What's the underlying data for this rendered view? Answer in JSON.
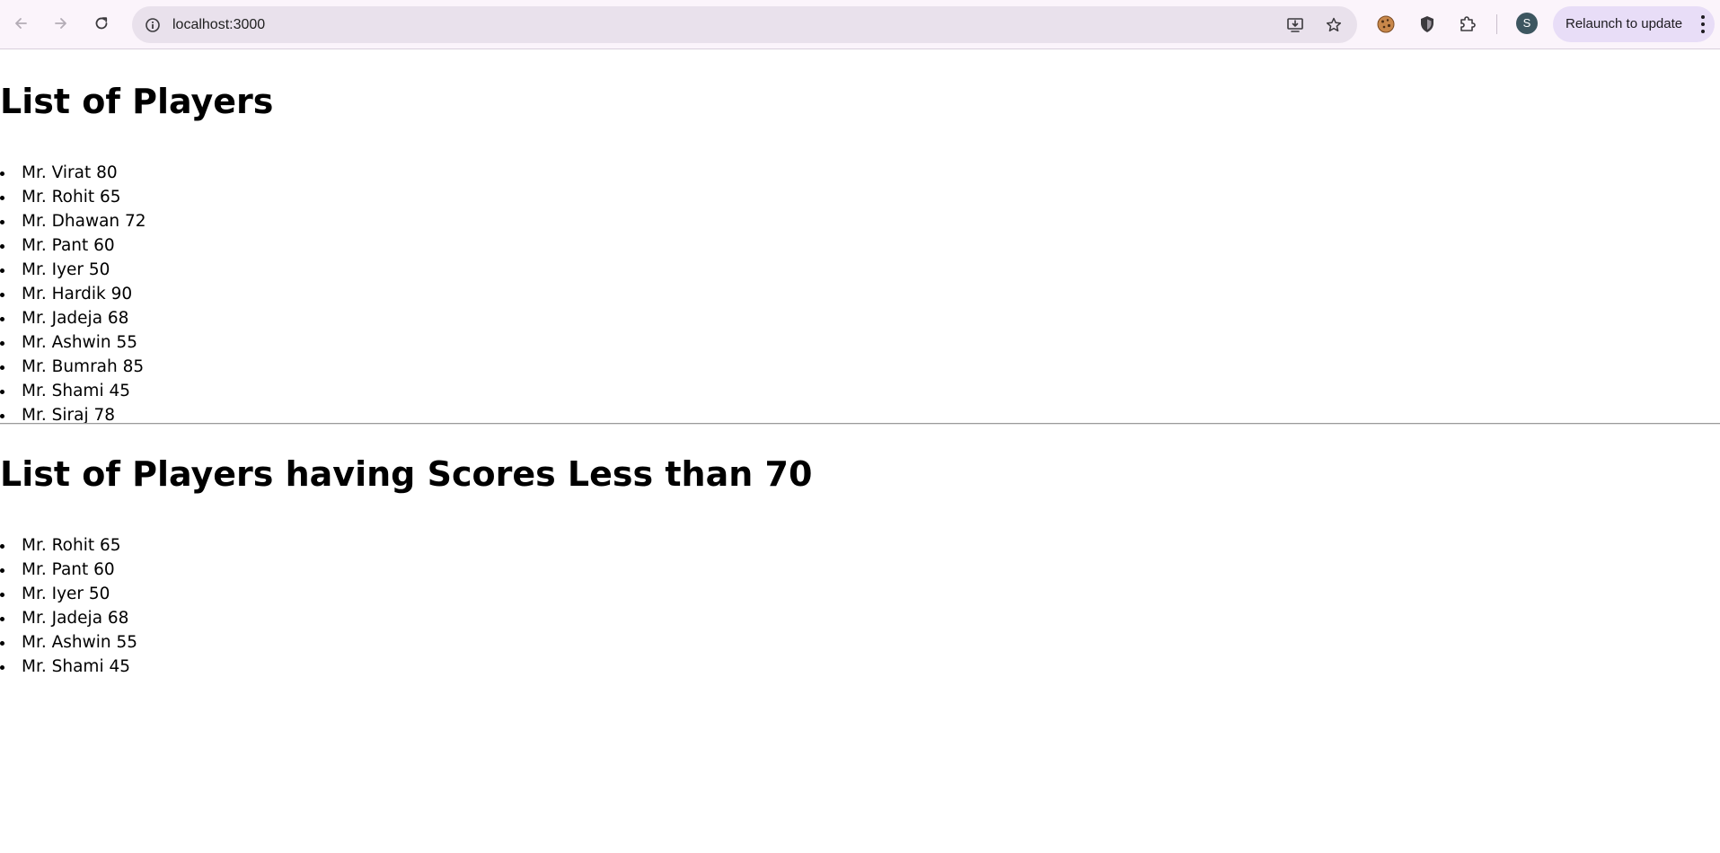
{
  "browser": {
    "url": "localhost:3000",
    "profile_initial": "S",
    "relaunch_label": "Relaunch to update",
    "icons": {
      "back": "back-arrow-icon",
      "forward": "forward-arrow-icon",
      "reload": "reload-icon",
      "site_info": "info-icon",
      "install": "install-app-icon",
      "bookmark": "star-icon",
      "extension_cookie": "cookie-icon",
      "extension_shield": "shield-icon",
      "extensions": "puzzle-icon",
      "menu": "kebab-menu-icon"
    }
  },
  "content": {
    "all_players": {
      "heading": "List of Players",
      "items": [
        "Mr. Virat 80",
        "Mr. Rohit 65",
        "Mr. Dhawan 72",
        "Mr. Pant 60",
        "Mr. Iyer 50",
        "Mr. Hardik 90",
        "Mr. Jadeja 68",
        "Mr. Ashwin 55",
        "Mr. Bumrah 85",
        "Mr. Shami 45",
        "Mr. Siraj 78"
      ]
    },
    "low_scorers": {
      "heading": "List of Players having Scores Less than 70",
      "items": [
        "Mr. Rohit 65",
        "Mr. Pant 60",
        "Mr. Iyer 50",
        "Mr. Jadeja 68",
        "Mr. Ashwin 55",
        "Mr. Shami 45"
      ]
    }
  }
}
